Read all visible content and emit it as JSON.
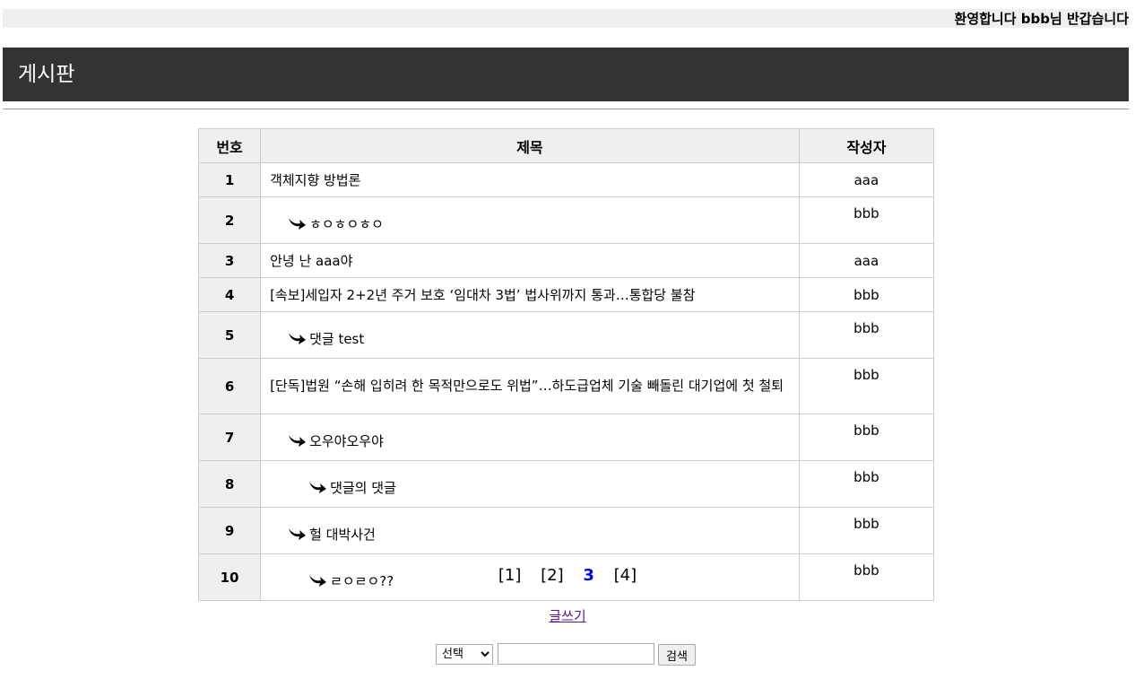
{
  "welcome": "환영합니다 bbb님 반갑습니다",
  "board_title": "게시판",
  "table": {
    "headers": [
      "번호",
      "제목",
      "작성자"
    ],
    "rows": [
      {
        "no": "1",
        "title": "객체지향 방법론",
        "author": "aaa",
        "reply_depth": 0
      },
      {
        "no": "2",
        "title": "ㅎㅇㅎㅇㅎㅇ",
        "author": "bbb",
        "reply_depth": 1
      },
      {
        "no": "3",
        "title": "안녕 난 aaa야",
        "author": "aaa",
        "reply_depth": 0
      },
      {
        "no": "4",
        "title": "[속보]세입자 2+2년 주거 보호 ‘임대차 3법’ 법사위까지 통과…통합당 불참",
        "author": "bbb",
        "reply_depth": 0
      },
      {
        "no": "5",
        "title": "댓글 test",
        "author": "bbb",
        "reply_depth": 1
      },
      {
        "no": "6",
        "title": "[단독]법원 “손해 입히려 한 목적만으로도 위법”…하도급업체 기술 빼돌린 대기업에 첫 철퇴",
        "author": "bbb",
        "reply_depth": 0
      },
      {
        "no": "7",
        "title": "오우야오우야",
        "author": "bbb",
        "reply_depth": 1
      },
      {
        "no": "8",
        "title": "댓글의 댓글",
        "author": "bbb",
        "reply_depth": 2
      },
      {
        "no": "9",
        "title": "헐 대박사건",
        "author": "bbb",
        "reply_depth": 1
      },
      {
        "no": "10",
        "title": "ㄹㅇㄹㅇ??",
        "author": "bbb",
        "reply_depth": 2
      }
    ]
  },
  "pagination": {
    "pages": [
      "[1]",
      "[2]",
      "3",
      "[4]"
    ],
    "current": "3"
  },
  "write_link": "글쓰기",
  "search": {
    "select_value": "선택",
    "input_value": "",
    "button_label": "검색"
  },
  "icons": {
    "reply": "reply-arrow-icon"
  }
}
